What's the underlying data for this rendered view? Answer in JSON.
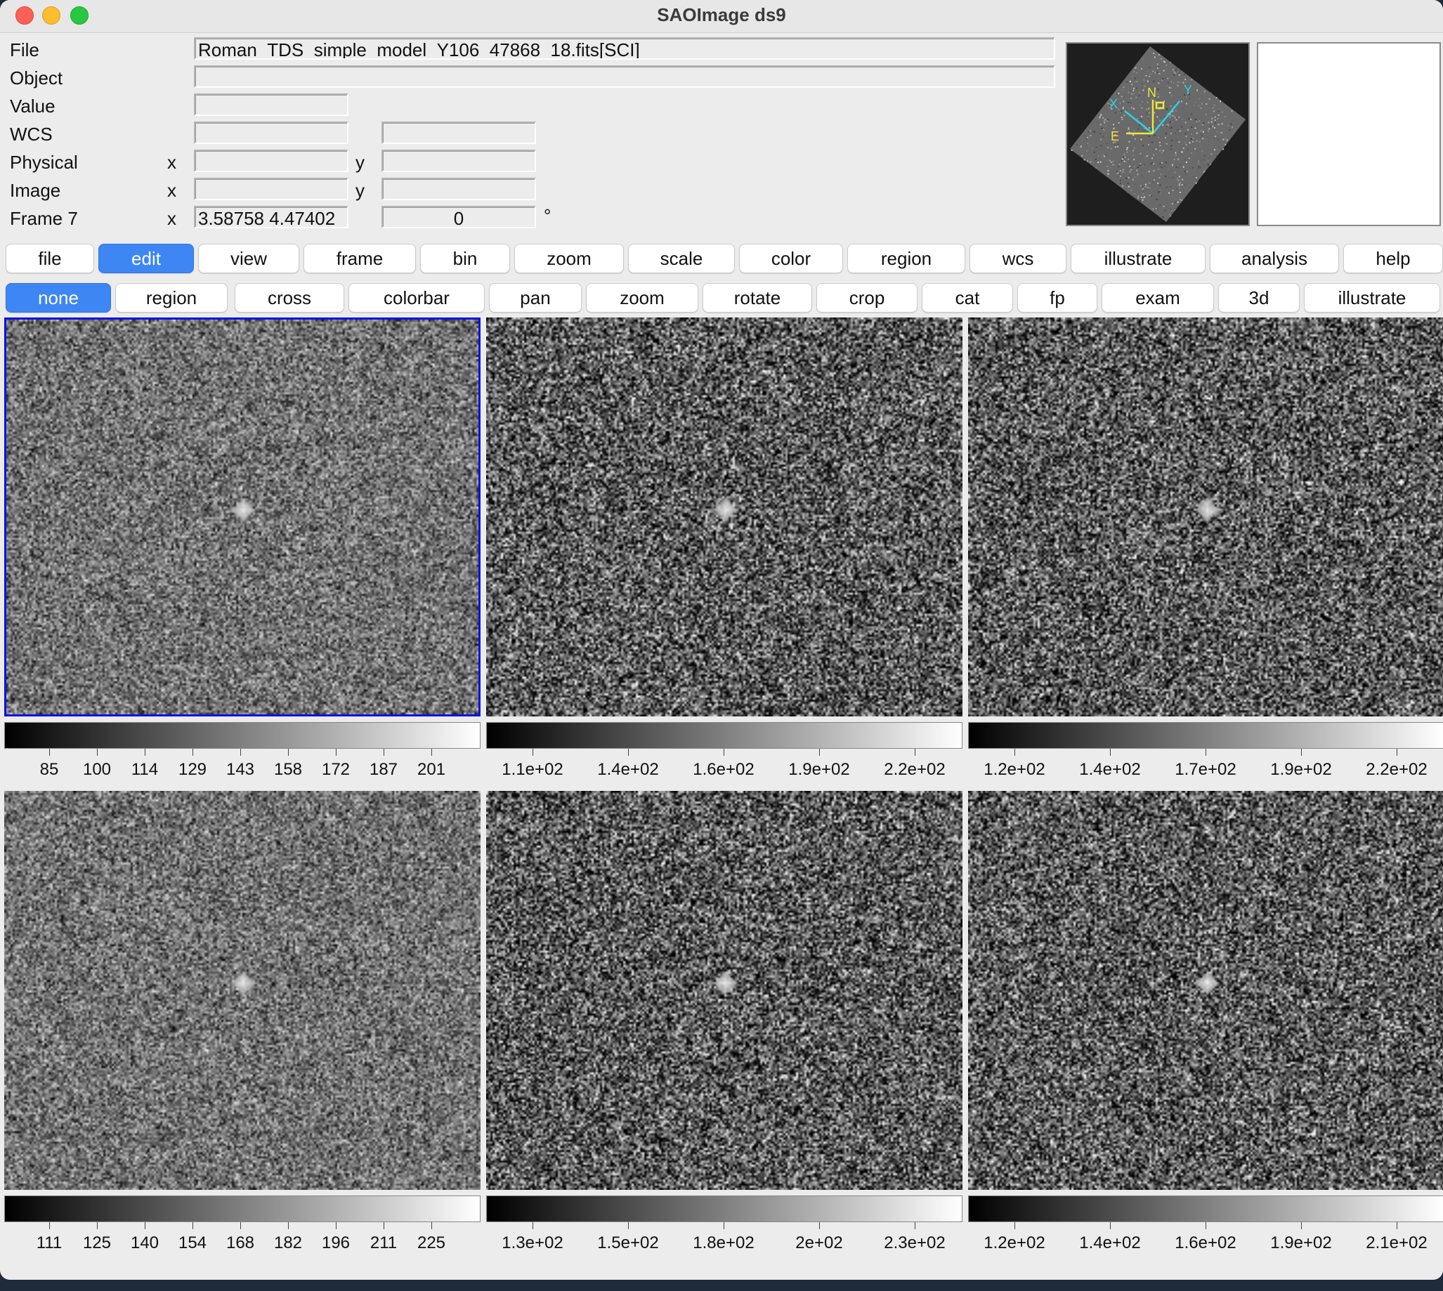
{
  "window": {
    "title": "SAOImage ds9"
  },
  "info_panel": {
    "rows": [
      {
        "label": "File",
        "value": "Roman_TDS_simple_model_Y106_47868_18.fits[SCI]"
      },
      {
        "label": "Object",
        "value": ""
      },
      {
        "label": "Value",
        "value": ""
      },
      {
        "label": "WCS",
        "value": "",
        "value2": ""
      },
      {
        "label": "Physical",
        "x_label": "x",
        "x_value": "",
        "y_label": "y",
        "y_value": ""
      },
      {
        "label": "Image",
        "x_label": "x",
        "x_value": "",
        "y_label": "y",
        "y_value": ""
      },
      {
        "label": "Frame 7",
        "x_label": "x",
        "x_value": "3.58758 4.47402",
        "angle_value": "0",
        "angle_unit": "°"
      }
    ]
  },
  "panner": {
    "compass": {
      "x": "X",
      "y": "Y",
      "n": "N",
      "e": "E"
    }
  },
  "menu_bar": {
    "items": [
      "file",
      "edit",
      "view",
      "frame",
      "bin",
      "zoom",
      "scale",
      "color",
      "region",
      "wcs",
      "illustrate",
      "analysis",
      "help"
    ],
    "active": "edit"
  },
  "mode_bar": {
    "items": [
      "none",
      "region",
      "cross",
      "colorbar",
      "pan",
      "zoom",
      "rotate",
      "crop",
      "cat",
      "fp",
      "exam",
      "3d",
      "illustrate"
    ],
    "active": "none"
  },
  "frames": [
    {
      "current": true,
      "colorbar_ticks": [
        "85",
        "100",
        "114",
        "129",
        "143",
        "158",
        "172",
        "187",
        "201"
      ]
    },
    {
      "current": false,
      "colorbar_ticks": [
        "1.1e+02",
        "1.4e+02",
        "1.6e+02",
        "1.9e+02",
        "2.2e+02"
      ]
    },
    {
      "current": false,
      "colorbar_ticks": [
        "1.2e+02",
        "1.4e+02",
        "1.7e+02",
        "1.9e+02",
        "2.2e+02"
      ]
    },
    {
      "current": false,
      "colorbar_ticks": [
        "111",
        "125",
        "140",
        "154",
        "168",
        "182",
        "196",
        "211",
        "225"
      ]
    },
    {
      "current": false,
      "colorbar_ticks": [
        "1.3e+02",
        "1.5e+02",
        "1.8e+02",
        "2e+02",
        "2.3e+02"
      ]
    },
    {
      "current": false,
      "colorbar_ticks": [
        "1.2e+02",
        "1.4e+02",
        "1.6e+02",
        "1.9e+02",
        "2.1e+02"
      ]
    }
  ],
  "colors": {
    "active_button": "#3d86f4",
    "current_frame_border": "#1010e6",
    "compass_cyan": "#2ad4e6",
    "compass_yellow": "#f2e53a"
  }
}
